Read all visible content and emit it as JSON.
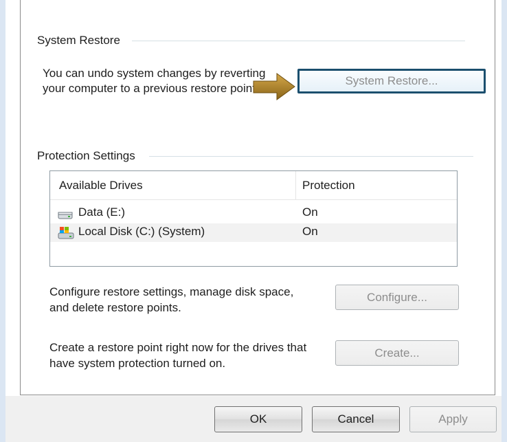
{
  "system_restore": {
    "title": "System Restore",
    "description_line1": "You can undo system changes by reverting",
    "description_line2": "your computer to a previous restore point.",
    "button": "System Restore..."
  },
  "protection_settings": {
    "title": "Protection Settings",
    "columns": [
      "Available Drives",
      "Protection"
    ],
    "drives": [
      {
        "name": "Data (E:)",
        "protection": "On",
        "icon": "hard-drive-icon"
      },
      {
        "name": "Local Disk (C:) (System)",
        "protection": "On",
        "icon": "system-drive-icon"
      }
    ],
    "configure_text_line1": "Configure restore settings, manage disk space,",
    "configure_text_line2": "and delete restore points.",
    "configure_button": "Configure...",
    "create_text_line1": "Create a restore point right now for the drives that",
    "create_text_line2": "have system protection turned on.",
    "create_button": "Create..."
  },
  "footer": {
    "ok": "OK",
    "cancel": "Cancel",
    "apply": "Apply"
  },
  "colors": {
    "focus_border": "#1b4f6e",
    "arrow": "#b08a2a",
    "frame": "#dbe6f3"
  }
}
